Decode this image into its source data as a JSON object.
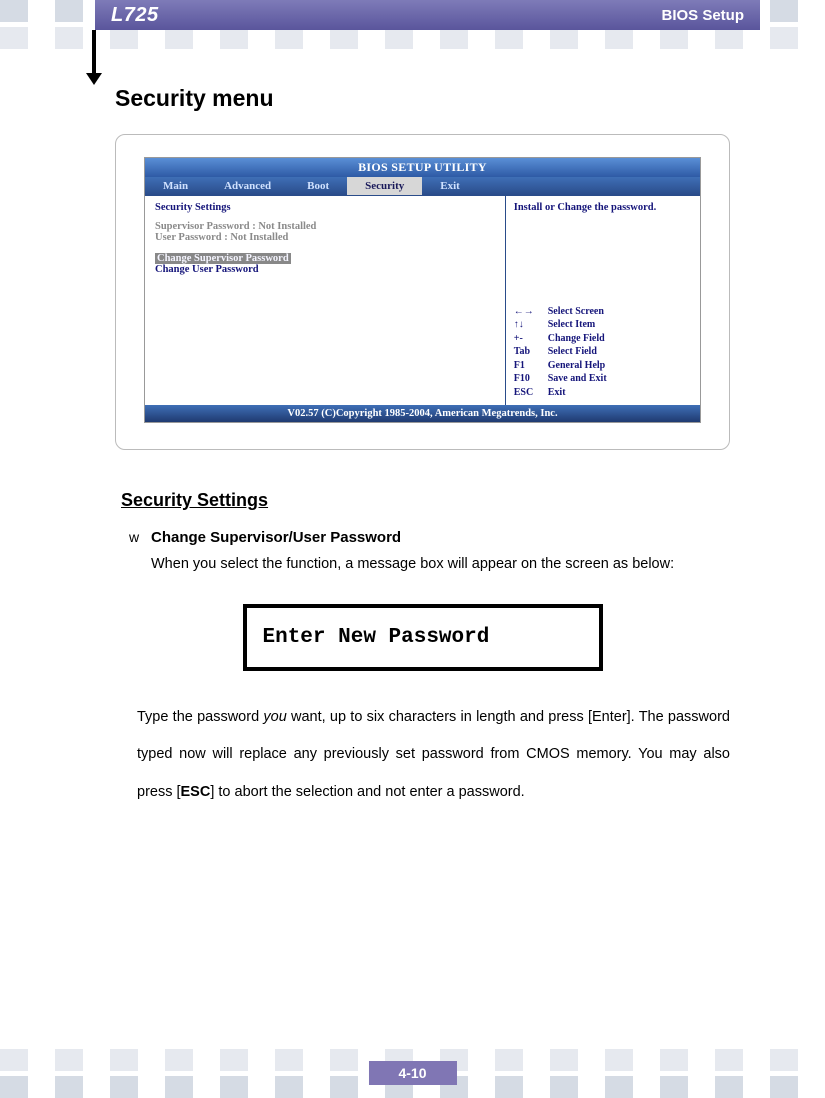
{
  "header": {
    "model": "L725",
    "chapter": "BIOS Setup"
  },
  "section_title": "Security menu",
  "bios": {
    "title": "BIOS SETUP UTILITY",
    "tabs": [
      "Main",
      "Advanced",
      "Boot",
      "Security",
      "Exit"
    ],
    "active_tab": "Security",
    "left": {
      "heading": "Security Settings",
      "lines": [
        "Supervisor Password  : Not Installed",
        "User Password            : Not Installed"
      ],
      "selected": "Change Supervisor Password",
      "blue": "Change User Password"
    },
    "right_hint": "Install or Change the password.",
    "keys": [
      {
        "k": "←→",
        "d": "Select Screen"
      },
      {
        "k": "↑↓",
        "d": "Select Item"
      },
      {
        "k": "+-",
        "d": "Change Field"
      },
      {
        "k": "Tab",
        "d": "Select Field"
      },
      {
        "k": "F1",
        "d": "General Help"
      },
      {
        "k": "F10",
        "d": "Save and Exit"
      },
      {
        "k": "ESC",
        "d": "Exit"
      }
    ],
    "footer": "V02.57 (C)Copyright 1985-2004, American Megatrends, Inc."
  },
  "subsection": "Security Settings",
  "bullet_symbol": "w",
  "bullet_title": "Change Supervisor/User Password",
  "para1": "When you select the function, a message box will appear on the screen as below:",
  "password_box": "Enter New Password",
  "para2_pre": "Type the password ",
  "para2_em": "you",
  "para2_mid": " want, up to six characters in length and press [Enter].   The password typed now will replace any previously set password from CMOS memory. You may also press [",
  "para2_bold": "ESC",
  "para2_post": "] to abort the selection and not enter a password.",
  "page_number": "4-10"
}
